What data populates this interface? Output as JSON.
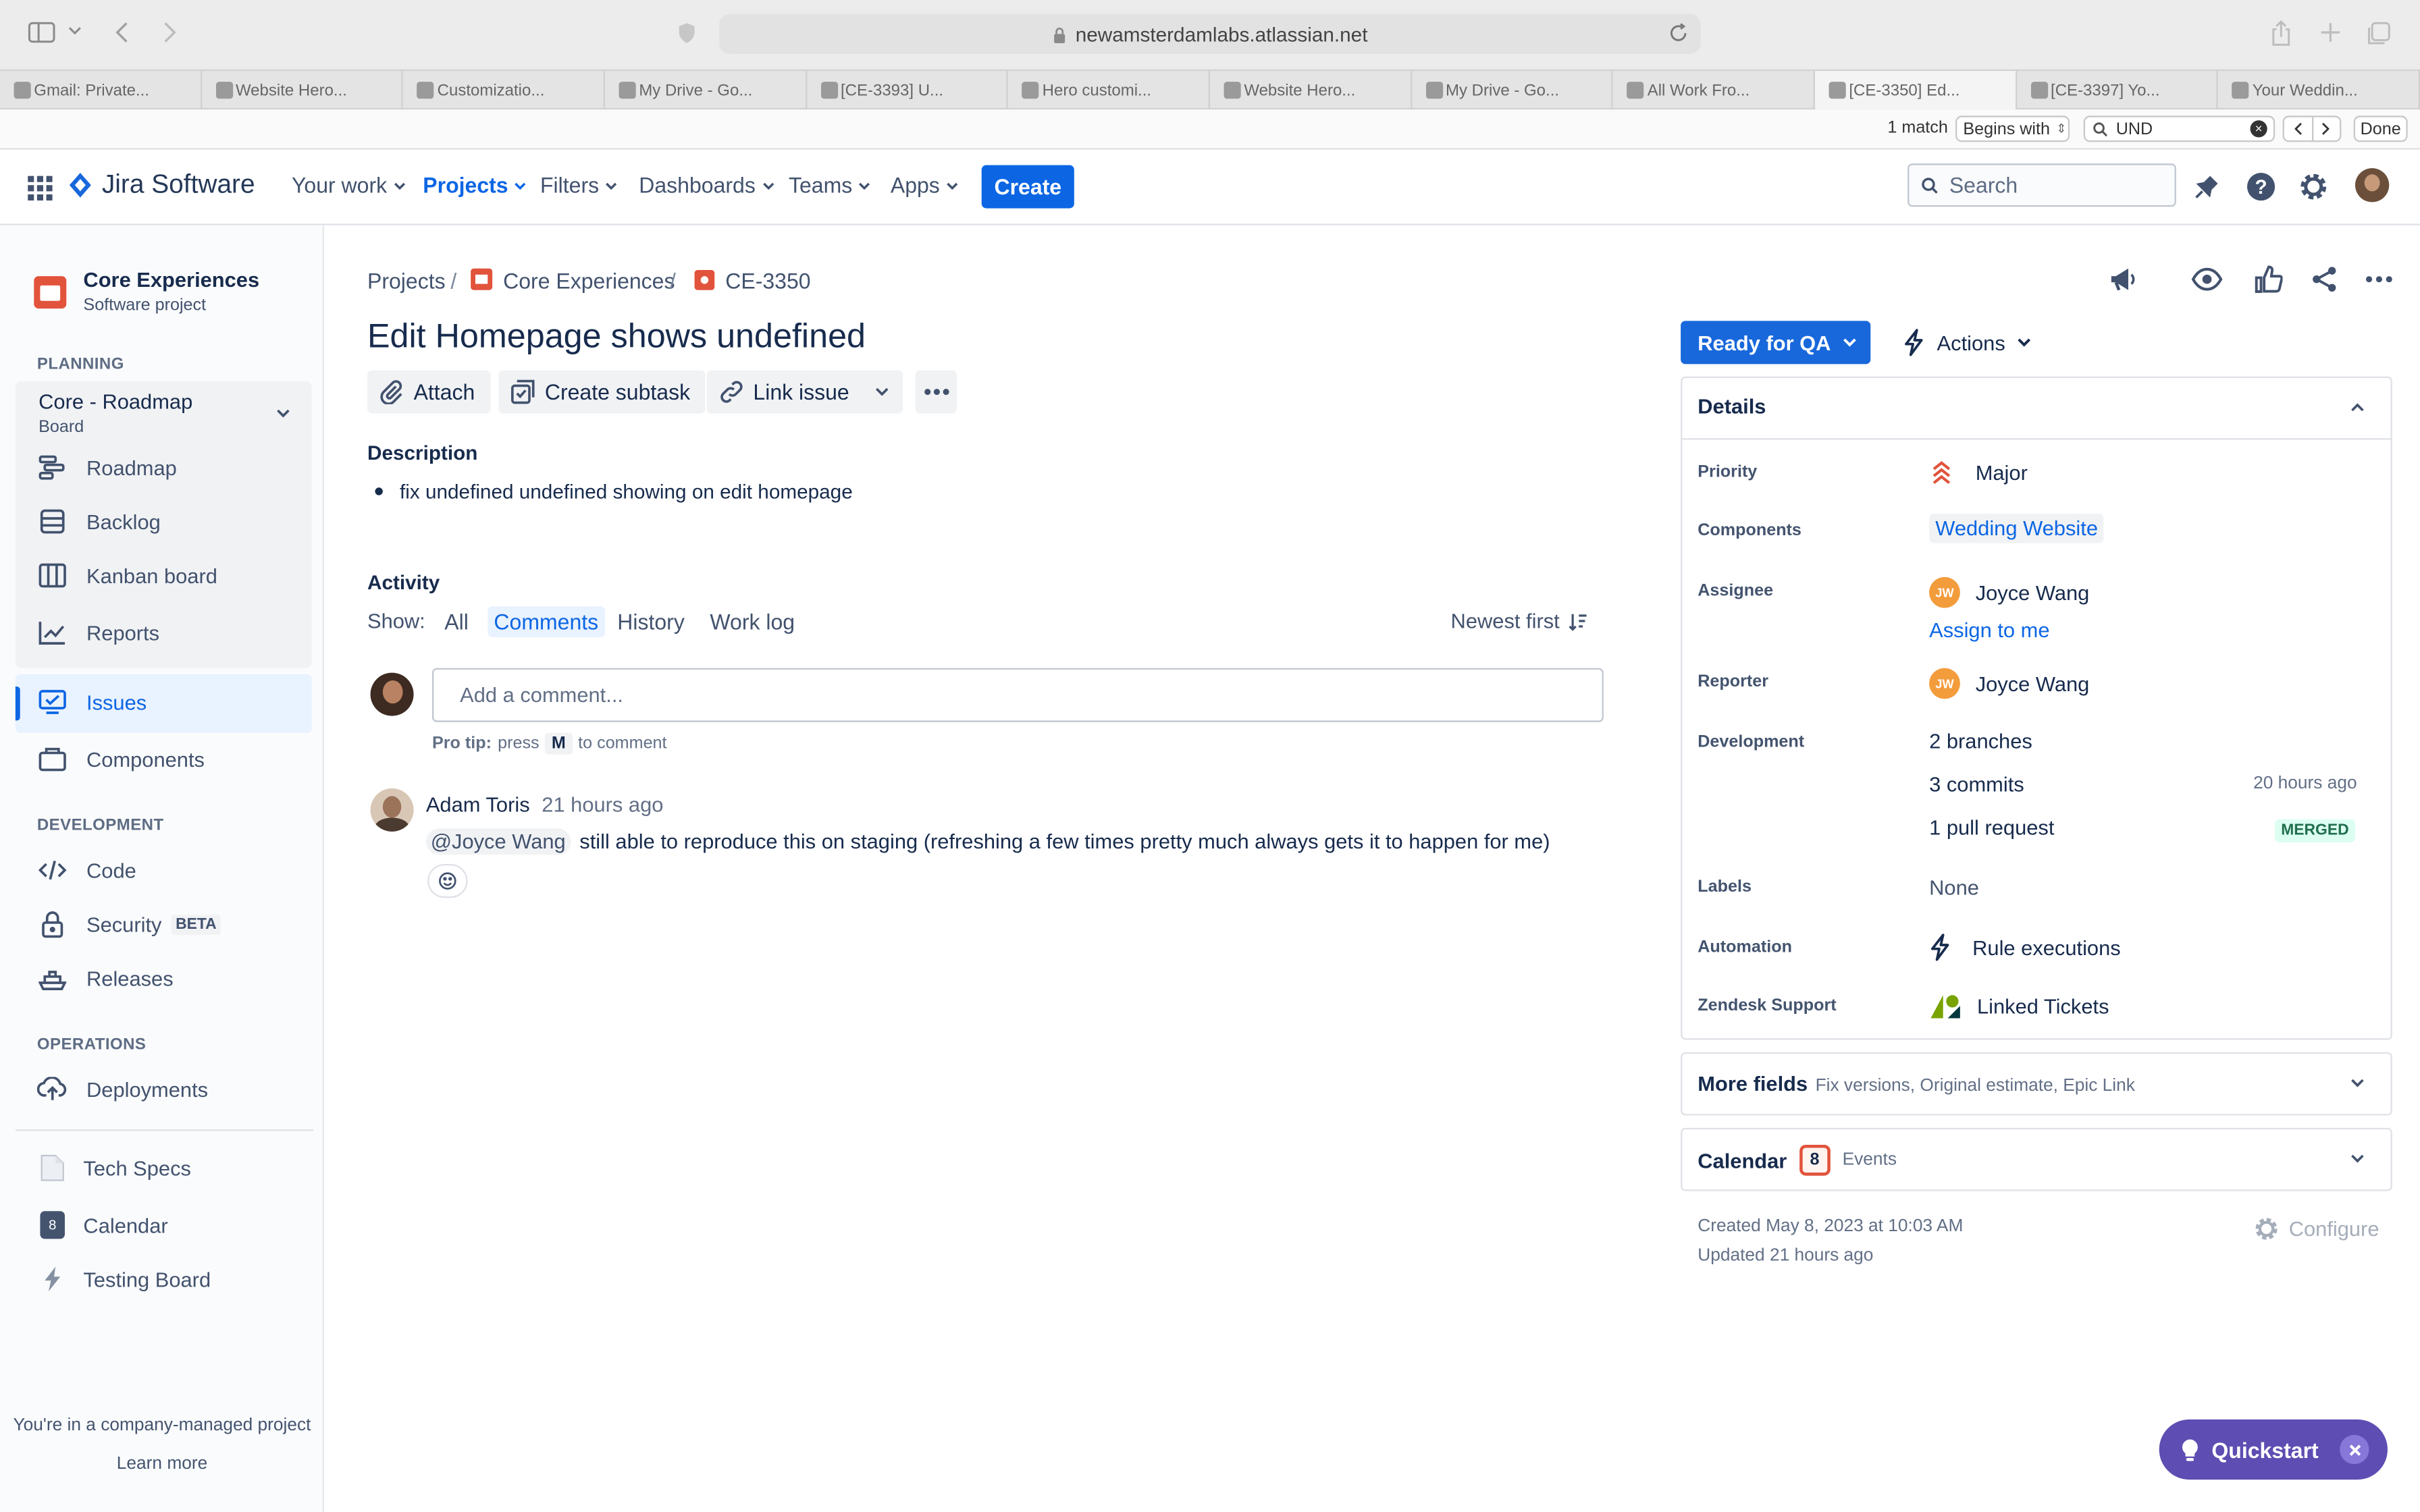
{
  "browser": {
    "url": "newamsterdamlabs.atlassian.net",
    "tabs": [
      {
        "title": "Gmail: Private..."
      },
      {
        "title": "Website Hero..."
      },
      {
        "title": "Customizatio..."
      },
      {
        "title": "My Drive - Go..."
      },
      {
        "title": "[CE-3393] U..."
      },
      {
        "title": "Hero customi..."
      },
      {
        "title": "Website Hero..."
      },
      {
        "title": "My Drive - Go..."
      },
      {
        "title": "All Work Fro..."
      },
      {
        "title": "[CE-3350] Ed..."
      },
      {
        "title": "[CE-3397] Yo..."
      },
      {
        "title": "Your Weddin..."
      }
    ],
    "find": {
      "match_count": "1 match",
      "mode": "Begins with",
      "query": "UND",
      "done_label": "Done"
    }
  },
  "header": {
    "product": "Jira Software",
    "nav": [
      "Your work",
      "Projects",
      "Filters",
      "Dashboards",
      "Teams",
      "Apps"
    ],
    "create_label": "Create",
    "search_placeholder": "Search"
  },
  "sidebar": {
    "project_name": "Core Experiences",
    "project_type": "Software project",
    "planning_heading": "PLANNING",
    "board_name": "Core - Roadmap",
    "board_sub": "Board",
    "planning_items": [
      "Roadmap",
      "Backlog",
      "Kanban board",
      "Reports"
    ],
    "issues_label": "Issues",
    "components_label": "Components",
    "development_heading": "DEVELOPMENT",
    "code_label": "Code",
    "security_label": "Security",
    "beta_label": "BETA",
    "releases_label": "Releases",
    "operations_heading": "OPERATIONS",
    "deployments_label": "Deployments",
    "shortcuts": [
      "Tech Specs",
      "Calendar",
      "Testing Board"
    ],
    "calendar_badge": "8",
    "footer_text": "You're in a company-managed project",
    "learn_more": "Learn more"
  },
  "issue": {
    "breadcrumb": [
      "Projects",
      "Core Experiences",
      "CE-3350"
    ],
    "title": "Edit Homepage shows undefined",
    "actions": {
      "attach": "Attach",
      "subtask": "Create subtask",
      "link": "Link issue"
    },
    "description_heading": "Description",
    "description_items": [
      "fix undefined undefined showing on edit homepage"
    ],
    "activity_heading": "Activity",
    "show_label": "Show:",
    "activity_tabs": [
      "All",
      "Comments",
      "History",
      "Work log"
    ],
    "sort_label": "Newest first",
    "comment_placeholder": "Add a comment...",
    "pro_tip": {
      "prefix": "Pro tip:",
      "press": "press",
      "key": "M",
      "suffix": "to comment"
    },
    "comments": [
      {
        "author": "Adam Toris",
        "time": "21 hours ago",
        "mention": "@Joyce Wang",
        "text": "still able to reproduce this on staging (refreshing a few times pretty much always gets it to happen for me)"
      }
    ]
  },
  "details": {
    "status": "Ready for QA",
    "actions_label": "Actions",
    "heading": "Details",
    "priority_label": "Priority",
    "priority_value": "Major",
    "components_label": "Components",
    "components_value": "Wedding Website",
    "assignee_label": "Assignee",
    "assignee_initials": "JW",
    "assignee_value": "Joyce Wang",
    "assign_to_me": "Assign to me",
    "reporter_label": "Reporter",
    "reporter_initials": "JW",
    "reporter_value": "Joyce Wang",
    "development_label": "Development",
    "branches": "2 branches",
    "commits": "3 commits",
    "commits_time": "20 hours ago",
    "pull_requests": "1 pull request",
    "pr_status": "MERGED",
    "labels_label": "Labels",
    "labels_value": "None",
    "automation_label": "Automation",
    "automation_value": "Rule executions",
    "zendesk_label": "Zendesk Support",
    "zendesk_value": "Linked Tickets",
    "more_fields_label": "More fields",
    "more_fields_hint": "Fix versions, Original estimate, Epic Link",
    "calendar_label": "Calendar",
    "calendar_count": "8",
    "calendar_events": "Events",
    "created": "Created May 8, 2023 at 10:03 AM",
    "updated": "Updated 21 hours ago",
    "configure_label": "Configure"
  },
  "quickstart_label": "Quickstart",
  "colors": {
    "brand": "#0c66e4",
    "status": "#1868db",
    "priority": "#e2533c",
    "merged_bg": "#dcfff1",
    "merged_text": "#216e4e"
  }
}
